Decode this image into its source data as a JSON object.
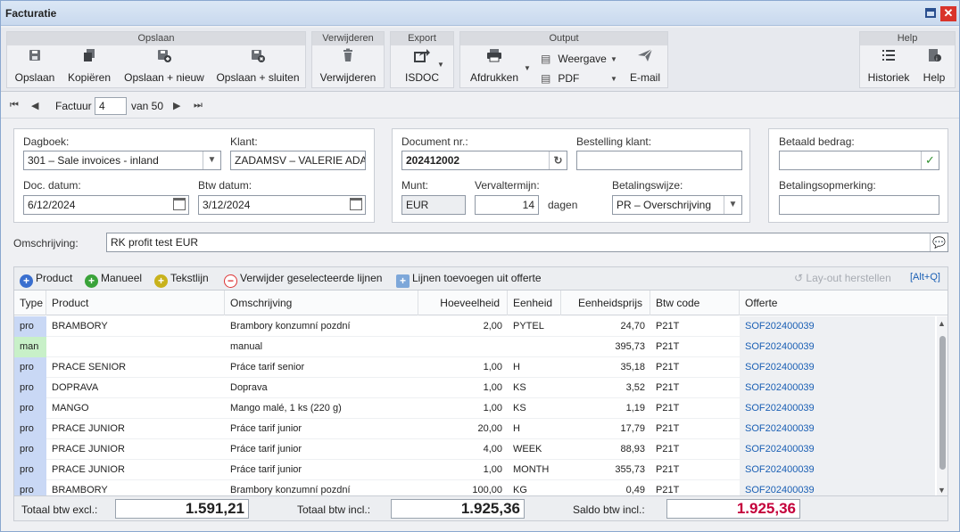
{
  "window": {
    "title": "Facturatie"
  },
  "ribbon": {
    "opslaan": {
      "title": "Opslaan",
      "save": "Opslaan",
      "copy": "Kopiëren",
      "save_new": "Opslaan + nieuw",
      "save_close": "Opslaan + sluiten"
    },
    "verwijderen": {
      "title": "Verwijderen",
      "delete": "Verwijderen"
    },
    "export": {
      "title": "Export",
      "isdoc": "ISDOC"
    },
    "output": {
      "title": "Output",
      "print": "Afdrukken",
      "view": "Weergave",
      "pdf": "PDF",
      "email": "E-mail"
    },
    "help": {
      "title": "Help",
      "history": "Historiek",
      "help": "Help"
    }
  },
  "nav": {
    "label": "Factuur",
    "current": "4",
    "of": "van 50"
  },
  "header": {
    "dagboek_label": "Dagboek:",
    "dagboek": "301 – Sale invoices - inland",
    "klant_label": "Klant:",
    "klant": "ZADAMSV – VALERIE ADAM",
    "doc_datum_label": "Doc. datum:",
    "doc_datum": "6/12/2024",
    "btw_datum_label": "Btw datum:",
    "btw_datum": "3/12/2024",
    "document_nr_label": "Document nr.:",
    "document_nr": "202412002",
    "bestelling_label": "Bestelling klant:",
    "bestelling": "",
    "munt_label": "Munt:",
    "munt": "EUR",
    "vervaltermijn_label": "Vervaltermijn:",
    "vervaltermijn": "14",
    "dagen": "dagen",
    "betalingswijze_label": "Betalingswijze:",
    "betalingswijze": "PR – Overschrijving",
    "betaald_label": "Betaald bedrag:",
    "betaald": "",
    "betaling_opm_label": "Betalingsopmerking:",
    "betaling_opm": "",
    "omschrijving_label": "Omschrijving:",
    "omschrijving": "RK profit test EUR"
  },
  "grid_toolbar": {
    "product": "Product",
    "manueel": "Manueel",
    "tekstlijn": "Tekstlijn",
    "verwijder": "Verwijder geselecteerde lijnen",
    "toevoegen": "Lijnen toevoegen uit offerte",
    "layout": "Lay-out herstellen",
    "shortcut": "[Alt+Q]"
  },
  "grid": {
    "columns": [
      "Type",
      "Product",
      "Omschrijving",
      "Hoeveelheid",
      "Eenheid",
      "Eenheidsprijs",
      "Btw code",
      "Offerte"
    ],
    "rows": [
      {
        "type": "pro",
        "product": "BRAMBORY",
        "omschrijving": "Brambory konzumní pozdní",
        "hoeveelheid": "2,00",
        "eenheid": "PYTEL",
        "prijs": "24,70",
        "btw": "P21T",
        "offerte": "SOF202400039"
      },
      {
        "type": "man",
        "product": "",
        "omschrijving": "manual",
        "hoeveelheid": "",
        "eenheid": "",
        "prijs": "395,73",
        "btw": "P21T",
        "offerte": "SOF202400039"
      },
      {
        "type": "pro",
        "product": "PRACE SENIOR",
        "omschrijving": "Práce tarif senior",
        "hoeveelheid": "1,00",
        "eenheid": "H",
        "prijs": "35,18",
        "btw": "P21T",
        "offerte": "SOF202400039"
      },
      {
        "type": "pro",
        "product": "DOPRAVA",
        "omschrijving": "Doprava",
        "hoeveelheid": "1,00",
        "eenheid": "KS",
        "prijs": "3,52",
        "btw": "P21T",
        "offerte": "SOF202400039"
      },
      {
        "type": "pro",
        "product": "MANGO",
        "omschrijving": "Mango malé, 1 ks (220 g)",
        "hoeveelheid": "1,00",
        "eenheid": "KS",
        "prijs": "1,19",
        "btw": "P21T",
        "offerte": "SOF202400039"
      },
      {
        "type": "pro",
        "product": "PRACE JUNIOR",
        "omschrijving": "Práce tarif junior",
        "hoeveelheid": "20,00",
        "eenheid": "H",
        "prijs": "17,79",
        "btw": "P21T",
        "offerte": "SOF202400039"
      },
      {
        "type": "pro",
        "product": "PRACE JUNIOR",
        "omschrijving": "Práce tarif junior",
        "hoeveelheid": "4,00",
        "eenheid": "WEEK",
        "prijs": "88,93",
        "btw": "P21T",
        "offerte": "SOF202400039"
      },
      {
        "type": "pro",
        "product": "PRACE JUNIOR",
        "omschrijving": "Práce tarif junior",
        "hoeveelheid": "1,00",
        "eenheid": "MONTH",
        "prijs": "355,73",
        "btw": "P21T",
        "offerte": "SOF202400039"
      },
      {
        "type": "pro",
        "product": "BRAMBORY",
        "omschrijving": "Brambory konzumní pozdní",
        "hoeveelheid": "100,00",
        "eenheid": "KG",
        "prijs": "0,49",
        "btw": "P21T",
        "offerte": "SOF202400039"
      }
    ]
  },
  "totals": {
    "excl_label": "Totaal btw excl.:",
    "excl": "1.591,21",
    "incl_label": "Totaal btw incl.:",
    "incl": "1.925,36",
    "saldo_label": "Saldo btw incl.:",
    "saldo": "1.925,36"
  },
  "colors": {
    "pro_bg": "#c9d8f5",
    "man_bg": "#c8f0c8",
    "saldo": "#c4003b",
    "link": "#1a5fb4"
  }
}
